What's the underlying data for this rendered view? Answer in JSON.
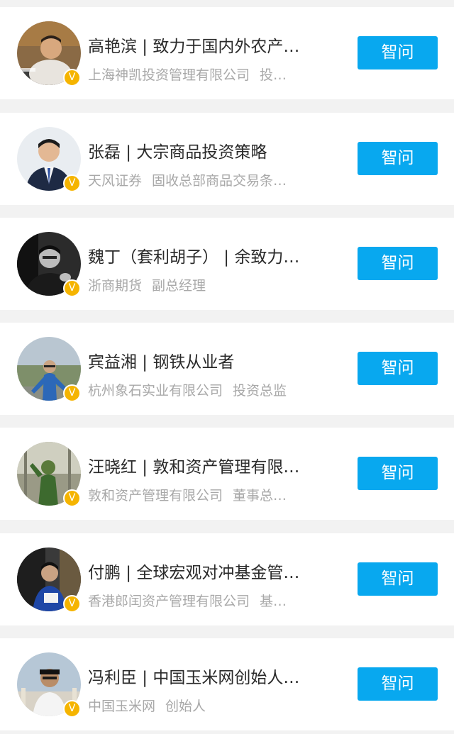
{
  "button_label": "智问",
  "verified_badge": "V",
  "colors": {
    "background": "#f2f2f2",
    "card": "#ffffff",
    "button": "#08a8ef",
    "badge": "#f5b400",
    "title_text": "#2a2a2a",
    "subtitle_text": "#a8a8a8"
  },
  "experts": [
    {
      "title": "高艳滨 | 致力于国内外农产…",
      "org": "上海神凯投资管理有限公司",
      "position": "投…"
    },
    {
      "title": "张磊 | 大宗商品投资策略",
      "org": "天风证券",
      "position": "固收总部商品交易条…"
    },
    {
      "title": "魏丁（套利胡子） | 余致力…",
      "org": "浙商期货",
      "position": "副总经理"
    },
    {
      "title": "宾益湘 | 钢铁从业者",
      "org": "杭州象石实业有限公司",
      "position": "投资总监"
    },
    {
      "title": "汪晓红 | 敦和资产管理有限…",
      "org": "敦和资产管理有限公司",
      "position": "董事总…"
    },
    {
      "title": "付鹏 | 全球宏观对冲基金管…",
      "org": "香港郎闰资产管理有限公司",
      "position": "基…"
    },
    {
      "title": "冯利臣 | 中国玉米网创始人…",
      "org": "中国玉米网",
      "position": "创始人"
    }
  ]
}
